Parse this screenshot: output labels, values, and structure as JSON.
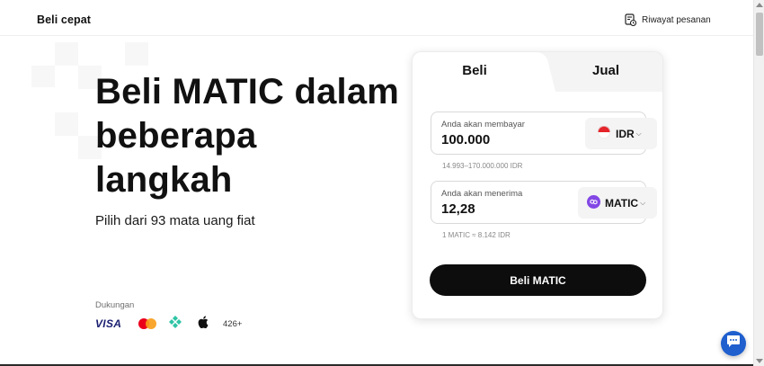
{
  "header": {
    "title": "Beli cepat",
    "history_label": "Riwayat pesanan"
  },
  "hero": {
    "title_line1": "Beli MATIC dalam",
    "title_line2": "beberapa",
    "title_line3": "langkah",
    "subtitle": "Pilih dari 93 mata uang fiat"
  },
  "support": {
    "label": "Dukungan",
    "visa": "VISA",
    "more": "426+"
  },
  "card": {
    "tab_buy": "Beli",
    "tab_sell": "Jual",
    "pay": {
      "label": "Anda akan membayar",
      "value": "100.000",
      "currency": "IDR",
      "range": "14.993–170.000.000 IDR"
    },
    "receive": {
      "label": "Anda akan menerima",
      "value": "12,28",
      "currency": "MATIC",
      "rate": "1 MATIC ≈ 8.142 IDR"
    },
    "button": "Beli MATIC"
  },
  "colors": {
    "accent": "#0d0d0d",
    "chat": "#1f5fce",
    "matic": "#8247e5",
    "idr_red": "#e5242b"
  },
  "icons": {
    "history": "receipt-clock-icon",
    "idr": "indonesia-flag-icon",
    "matic": "polygon-matic-icon",
    "chat": "chat-bubble-icon"
  }
}
